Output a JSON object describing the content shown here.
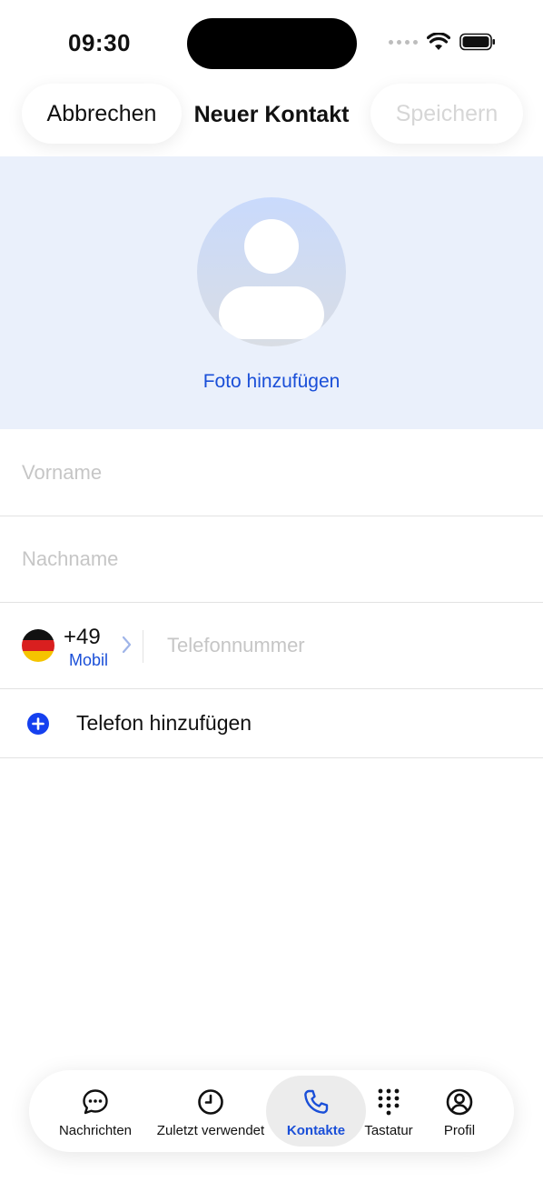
{
  "status_bar": {
    "time": "09:30"
  },
  "header": {
    "cancel_label": "Abbrechen",
    "title": "Neuer Kontakt",
    "save_label": "Speichern"
  },
  "photo": {
    "add_label": "Foto hinzufügen"
  },
  "form": {
    "first_name": {
      "value": "",
      "placeholder": "Vorname"
    },
    "last_name": {
      "value": "",
      "placeholder": "Nachname"
    },
    "phone": {
      "country_code": "+49",
      "type": "Mobil",
      "flag": "germany-flag",
      "value": "",
      "placeholder": "Telefonnummer"
    },
    "add_phone_label": "Telefon hinzufügen"
  },
  "tabbar": {
    "active": "Kontakte",
    "tabs": [
      {
        "label": "Nachrichten",
        "icon": "chat-bubble-icon"
      },
      {
        "label": "Zuletzt verwendet",
        "icon": "clock-icon"
      },
      {
        "label": "Kontakte",
        "icon": "phone-icon"
      },
      {
        "label": "Tastatur",
        "icon": "keypad-icon"
      },
      {
        "label": "Profil",
        "icon": "profile-icon"
      }
    ]
  },
  "colors": {
    "accent": "#1a4fd8",
    "plus_button": "#1540ef",
    "photo_background": "#eaf0fb",
    "disabled_text": "#d6d6d6",
    "placeholder_text": "#c6c6c6"
  }
}
